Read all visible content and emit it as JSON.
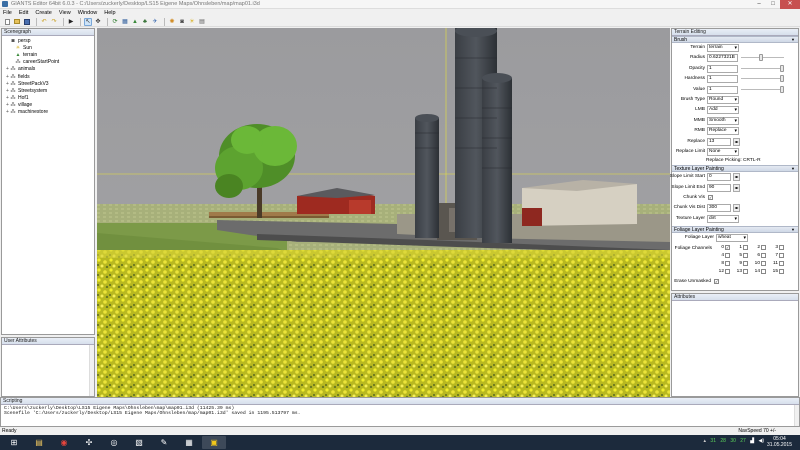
{
  "title": "GIANTS Editor 64bit 6.0.3 - C:/Users/zuckerly/Desktop/LS15 Eigene Maps/Ohnsleben/map/map01.i3d",
  "window_buttons": {
    "minimize": "–",
    "maximize": "□",
    "close": "✕"
  },
  "menu": [
    "File",
    "Edit",
    "Create",
    "View",
    "Window",
    "Help"
  ],
  "toolbar_icons": [
    "new-file-icon",
    "open-icon",
    "save-icon",
    "undo-icon",
    "redo-icon",
    "play-icon",
    "select-tool-icon",
    "move-tool-icon",
    "rotate-tool-icon",
    "scale-tool-icon",
    "terrain-icon",
    "foliage-icon",
    "navigate-icon",
    "render-icon",
    "camera-icon",
    "light-icon",
    "grid-icon"
  ],
  "scenegraph": {
    "title": "Scenegraph",
    "items": [
      {
        "label": "persp",
        "indent": 0,
        "expander": "",
        "icon": "camera-icon"
      },
      {
        "label": "Sun",
        "indent": 1,
        "expander": "",
        "icon": "light-icon"
      },
      {
        "label": "terrain",
        "indent": 1,
        "expander": "",
        "icon": "terrain-icon"
      },
      {
        "label": "careerStartPoint",
        "indent": 1,
        "expander": "",
        "icon": "transform-icon"
      },
      {
        "label": "animals",
        "indent": 0,
        "expander": "+",
        "icon": "transform-icon"
      },
      {
        "label": "fields",
        "indent": 0,
        "expander": "+",
        "icon": "transform-icon"
      },
      {
        "label": "StreetPackV3",
        "indent": 0,
        "expander": "+",
        "icon": "transform-icon"
      },
      {
        "label": "Streetsystem",
        "indent": 0,
        "expander": "+",
        "icon": "transform-icon"
      },
      {
        "label": "Hof1",
        "indent": 0,
        "expander": "+",
        "icon": "transform-icon"
      },
      {
        "label": "village",
        "indent": 0,
        "expander": "+",
        "icon": "transform-icon"
      },
      {
        "label": "machinestore",
        "indent": 0,
        "expander": "+",
        "icon": "transform-icon"
      }
    ]
  },
  "user_attributes": {
    "title": "User Attributes"
  },
  "terrain_editing": {
    "title": "Terrain Editing",
    "brush": {
      "title": "Brush",
      "terrain_label": "Terrain",
      "terrain_value": "terrain",
      "radius_label": "Radius",
      "radius_value": "0.6227321B",
      "opacity_label": "Opacity",
      "opacity_value": "1",
      "hardness_label": "Hardness",
      "hardness_value": "1",
      "value_label": "Value",
      "value_value": "1",
      "brush_type_label": "Brush Type",
      "brush_type_value": "Round",
      "lmb_label": "LMB",
      "lmb_value": "Add",
      "mmb_label": "MMB",
      "mmb_value": "Smooth",
      "rmb_label": "RMB",
      "rmb_value": "Replace",
      "replace_label": "Replace",
      "replace_value": "13",
      "replace_limit_label": "Replace Limit",
      "replace_limit_value": "None",
      "replace_picking": "Replace Picking: CRTL-R",
      "slider_levels": {
        "radius": 0.45,
        "opacity": 1.0,
        "hardness": 1.0,
        "value": 1.0
      }
    },
    "texture": {
      "title": "Texture Layer Painting",
      "slope_start_label": "Slope Limit Start",
      "slope_start_value": "0",
      "slope_end_label": "Slope Limit End",
      "slope_end_value": "90",
      "chunk_vis_label": "Chunk Vis",
      "chunk_vis_checked": true,
      "chunk_vis_dist_label": "Chunk Vis Dist",
      "chunk_vis_dist_value": "300",
      "texture_layer_label": "Texture Layer",
      "texture_layer_value": "dirt"
    },
    "foliage": {
      "title": "Foliage Layer Painting",
      "foliage_layer_label": "Foliage Layer",
      "foliage_layer_value": "wheat",
      "channels_label": "Foliage Channels",
      "channels": [
        {
          "n": "0",
          "checked": true
        },
        {
          "n": "1",
          "checked": false
        },
        {
          "n": "2",
          "checked": false
        },
        {
          "n": "3",
          "checked": false
        },
        {
          "n": "4",
          "checked": false
        },
        {
          "n": "5",
          "checked": false
        },
        {
          "n": "6",
          "checked": false
        },
        {
          "n": "7",
          "checked": false
        },
        {
          "n": "8",
          "checked": false
        },
        {
          "n": "9",
          "checked": false
        },
        {
          "n": "10",
          "checked": false
        },
        {
          "n": "11",
          "checked": false
        },
        {
          "n": "12",
          "checked": false
        },
        {
          "n": "13",
          "checked": false
        },
        {
          "n": "14",
          "checked": false
        },
        {
          "n": "15",
          "checked": false
        }
      ],
      "erase_label": "Erase Unmasked",
      "erase_checked": true
    }
  },
  "attributes": {
    "title": "Attributes"
  },
  "scripting": {
    "title": "Scripting",
    "lines": [
      "C:\\Users\\zuckerly\\Desktop\\LS15 Eigene Maps\\Ohnsleben\\map\\map01.i3d (11425.39 ms)",
      "Scenefile 'C:/Users/zuckerly/Desktop/LS15 Eigene Maps/Ohnsleben/map/map01.i3d' saved in 1195.513797 ms."
    ]
  },
  "status": {
    "left": "Ready",
    "right": "NavSpeed 70 +/-"
  },
  "taskbar": {
    "apps": [
      {
        "name": "start-button",
        "glyph": "⊞"
      },
      {
        "name": "explorer-icon",
        "glyph": "▤"
      },
      {
        "name": "chrome-icon",
        "glyph": "◉"
      },
      {
        "name": "gamepad-icon",
        "glyph": "✣"
      },
      {
        "name": "steam-icon",
        "glyph": "◎"
      },
      {
        "name": "image-tool-icon",
        "glyph": "▧"
      },
      {
        "name": "paint-icon",
        "glyph": "✎"
      },
      {
        "name": "text-editor-icon",
        "glyph": "▦"
      },
      {
        "name": "giants-editor-icon",
        "glyph": "▣"
      }
    ],
    "tray_numbers": [
      "31",
      "28",
      "30",
      "27"
    ],
    "time": "05:04",
    "date": "31.05.2015"
  }
}
